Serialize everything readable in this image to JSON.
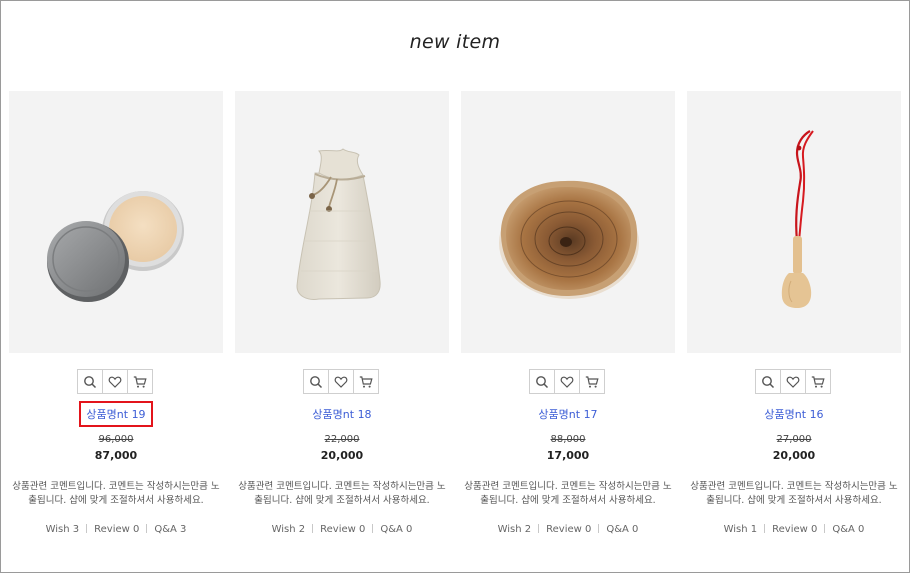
{
  "section": {
    "title": "new item"
  },
  "products": [
    {
      "image": "tin-balm-image",
      "name": "상품명nt 19",
      "highlighted": true,
      "old_price": "96,000",
      "price": "87,000",
      "desc_line1": "상품관련 코멘트입니다. 코멘트는 작성하시는만큼 노",
      "desc_line2": "출됩니다. 샵에 맞게 조절하셔서 사용하세요.",
      "wish": "Wish 3",
      "review": "Review 0",
      "qa": "Q&A 3"
    },
    {
      "image": "linen-pouch-image",
      "name": "상품명nt 18",
      "highlighted": false,
      "old_price": "22,000",
      "price": "20,000",
      "desc_line1": "상품관련 코멘트입니다. 코멘트는 작성하시는만큼 노",
      "desc_line2": "출됩니다. 샵에 맞게 조절하셔서 사용하세요.",
      "wish": "Wish 2",
      "review": "Review 0",
      "qa": "Q&A 0"
    },
    {
      "image": "wood-slice-image",
      "name": "상품명nt 17",
      "highlighted": false,
      "old_price": "88,000",
      "price": "17,000",
      "desc_line1": "상품관련 코멘트입니다. 코멘트는 작성하시는만큼 노",
      "desc_line2": "출됩니다. 샵에 맞게 조절하셔서 사용하세요.",
      "wish": "Wish 2",
      "review": "Review 0",
      "qa": "Q&A 0"
    },
    {
      "image": "wooden-spoon-image",
      "name": "상품명nt 16",
      "highlighted": false,
      "old_price": "27,000",
      "price": "20,000",
      "desc_line1": "상품관련 코멘트입니다. 코멘트는 작성하시는만큼 노",
      "desc_line2": "출됩니다. 샵에 맞게 조절하셔서 사용하세요.",
      "wish": "Wish 1",
      "review": "Review 0",
      "qa": "Q&A 0"
    }
  ],
  "action_icons": [
    "zoom-icon",
    "heart-icon",
    "cart-icon"
  ],
  "colors": {
    "link": "#3d5ed6",
    "highlight_box": "#e3141b",
    "thumb_bg": "#f3f3f3"
  }
}
